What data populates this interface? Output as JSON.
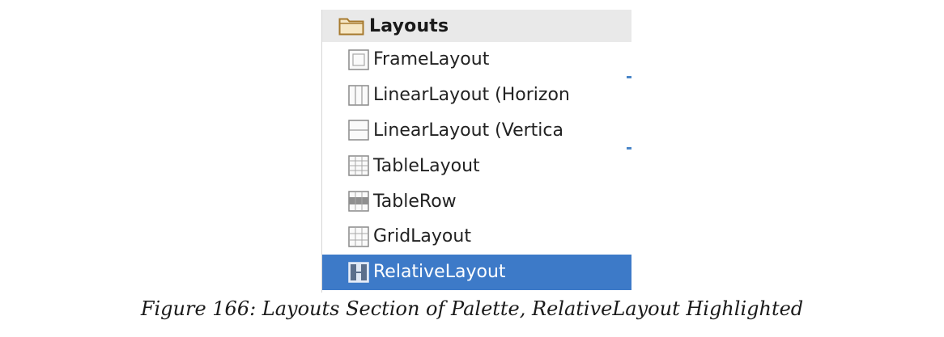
{
  "palette": {
    "section": {
      "title": "Layouts",
      "icon": "folder-icon"
    },
    "items": [
      {
        "label": "FrameLayout",
        "icon": "frame-layout-icon"
      },
      {
        "label": "LinearLayout (Horizon",
        "icon": "linear-layout-horizontal-icon"
      },
      {
        "label": "LinearLayout (Vertica",
        "icon": "linear-layout-vertical-icon"
      },
      {
        "label": "TableLayout",
        "icon": "table-layout-icon"
      },
      {
        "label": "TableRow",
        "icon": "table-row-icon"
      },
      {
        "label": "GridLayout",
        "icon": "grid-layout-icon"
      },
      {
        "label": "RelativeLayout",
        "icon": "relative-layout-icon",
        "selected": true
      }
    ],
    "colors": {
      "header_bg": "#e9e9e9",
      "selected_bg": "#3d7ac8",
      "folder": "#c8943c"
    }
  },
  "caption": "Figure 166: Layouts Section of Palette, RelativeLayout Highlighted"
}
